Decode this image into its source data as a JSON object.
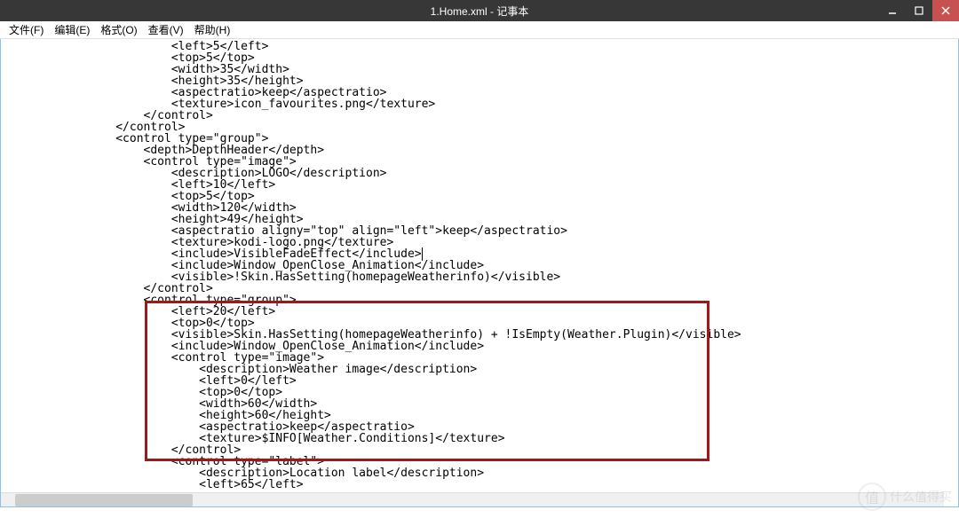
{
  "window": {
    "title": "1.Home.xml - 记事本"
  },
  "menu": {
    "file": "文件(F)",
    "edit": "编辑(E)",
    "format": "格式(O)",
    "view": "查看(V)",
    "help": "帮助(H)"
  },
  "code": {
    "l0": "                        <left>5</left>",
    "l1": "                        <top>5</top>",
    "l2": "                        <width>35</width>",
    "l3": "                        <height>35</height>",
    "l4": "                        <aspectratio>keep</aspectratio>",
    "l5": "                        <texture>icon_favourites.png</texture>",
    "l6": "                    </control>",
    "l7": "                </control>",
    "l8": "                <control type=\"group\">",
    "l9": "                    <depth>DepthHeader</depth>",
    "l10": "                    <control type=\"image\">",
    "l11": "                        <description>LOGO</description>",
    "l12": "                        <left>10</left>",
    "l13": "                        <top>5</top>",
    "l14": "                        <width>120</width>",
    "l15": "                        <height>49</height>",
    "l16": "                        <aspectratio aligny=\"top\" align=\"left\">keep</aspectratio>",
    "l17": "                        <texture>kodi-logo.png</texture>",
    "l18": "                        <include>VisibleFadeEffect</include>",
    "l19": "                        <include>Window_OpenClose_Animation</include>",
    "l20": "                        <visible>!Skin.HasSetting(homepageWeatherinfo)</visible>",
    "l21": "                    </control>",
    "l22": "                    <control type=\"group\">",
    "l23": "                        <left>20</left>",
    "l24": "                        <top>0</top>",
    "l25": "                        <visible>Skin.HasSetting(homepageWeatherinfo) + !IsEmpty(Weather.Plugin)</visible>",
    "l26": "                        <include>Window_OpenClose_Animation</include>",
    "l27": "                        <control type=\"image\">",
    "l28": "                            <description>Weather image</description>",
    "l29": "                            <left>0</left>",
    "l30": "                            <top>0</top>",
    "l31": "                            <width>60</width>",
    "l32": "                            <height>60</height>",
    "l33": "                            <aspectratio>keep</aspectratio>",
    "l34": "                            <texture>$INFO[Weather.Conditions]</texture>",
    "l35": "                        </control>",
    "l36": "                        <control type=\"label\">",
    "l37": "                            <description>Location label</description>",
    "l38": "                            <left>65</left>"
  },
  "watermark": {
    "badge": "值",
    "text": "什么值得买"
  }
}
